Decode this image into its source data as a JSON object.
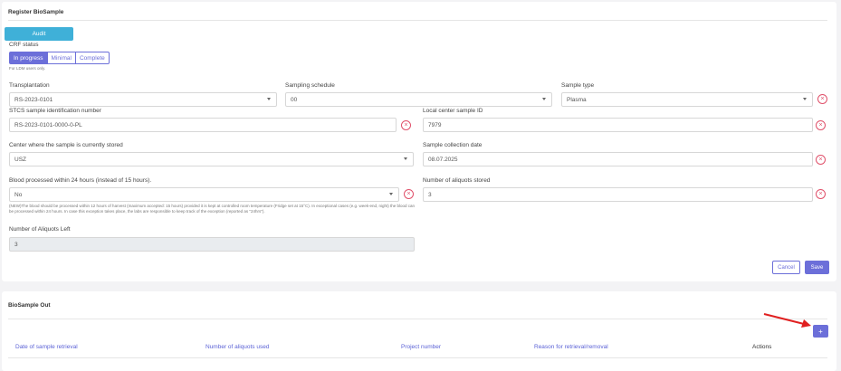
{
  "register": {
    "title": "Register BioSample",
    "audit_label": "Audit",
    "crf_label": "CRF status",
    "crf_options": [
      "In progress",
      "Minimal",
      "Complete"
    ],
    "crf_note": "For LDM users only.",
    "transplantation": {
      "label": "Transplantation",
      "value": "RS-2023-0101"
    },
    "sampling_schedule": {
      "label": "Sampling schedule",
      "value": "00"
    },
    "sample_type": {
      "label": "Sample type",
      "value": "Plasma"
    },
    "stcs_id": {
      "label": "STCS sample identification number",
      "value": "RS-2023-0101-0000-0-PL"
    },
    "local_id": {
      "label": "Local center sample ID",
      "value": "7979"
    },
    "center": {
      "label": "Center where the sample is currently stored",
      "value": "USZ"
    },
    "collection_date": {
      "label": "Sample collection date",
      "value": "08.07.2025"
    },
    "blood24": {
      "label": "Blood processed within 24 hours (instead of 15 hours).",
      "value": "No",
      "note": "(NEW)The blood should be processed within 12 hours of harvest (maximum accepted: 15 hours) provided it is kept at controlled room temperature (Fridge set at 15°C). In exceptional cases (e.g. week-end, night) the blood can be processed within 24 hours. In case this exception takes place, the labs are responsible to keep track of the exception (reported as \"24hrs\")."
    },
    "aliquots_stored": {
      "label": "Number of aliquots stored",
      "value": "3"
    },
    "aliquots_left": {
      "label": "Number of Aliquots Left",
      "value": "3"
    },
    "cancel_label": "Cancel",
    "save_label": "Save",
    "clear_symbol": "×"
  },
  "out": {
    "title": "BioSample Out",
    "add_label": "+",
    "columns": [
      "Date of sample retrieval",
      "Number of aliquots used",
      "Project number",
      "Reason for retrieval/removal",
      "Actions"
    ]
  },
  "colors": {
    "accent": "#6c6fd9",
    "audit": "#3fb0d8",
    "danger": "#e0506a",
    "arrow": "#e02020"
  }
}
